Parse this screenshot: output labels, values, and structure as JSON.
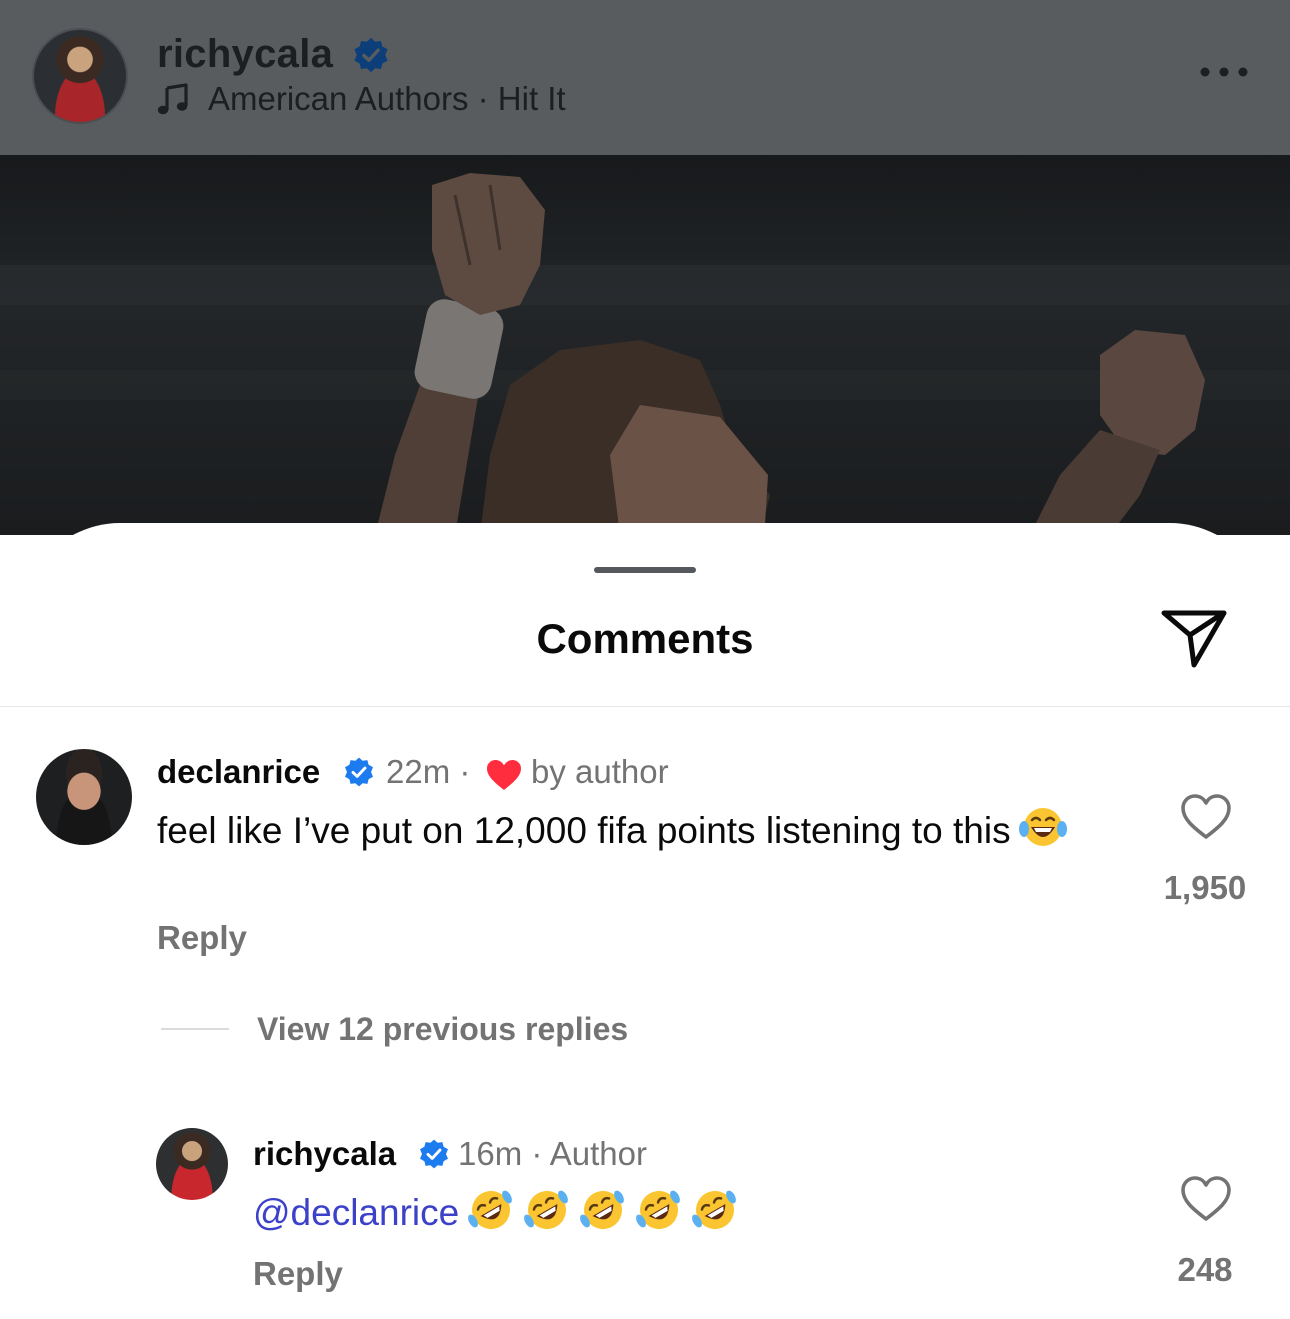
{
  "post": {
    "username": "richycala",
    "music": "American Authors · Hit It"
  },
  "sheet": {
    "title": "Comments"
  },
  "comments": [
    {
      "username": "declanrice",
      "time": "22m ·",
      "liked_by": "by author",
      "text": "feel like I’ve put on 12,000 fifa points listening to this",
      "reply_label": "Reply",
      "likes": "1,950"
    }
  ],
  "thread": {
    "view_replies": "View 12 previous replies"
  },
  "replies": [
    {
      "username": "richycala",
      "time": "16m · Author",
      "mention": "@declanrice",
      "reply_label": "Reply",
      "likes": "248"
    }
  ],
  "colors": {
    "verified": "#1d7bf0",
    "heart_red": "#ff2d3d",
    "mention": "#3c41c9",
    "secondary_text": "#737373"
  },
  "icons": [
    "music-note-icon",
    "verified-badge-icon",
    "more-options-icon",
    "share-send-icon",
    "red-heart-icon",
    "like-heart-icon",
    "laughing-emoji-icon",
    "rofl-emoji-icon"
  ]
}
